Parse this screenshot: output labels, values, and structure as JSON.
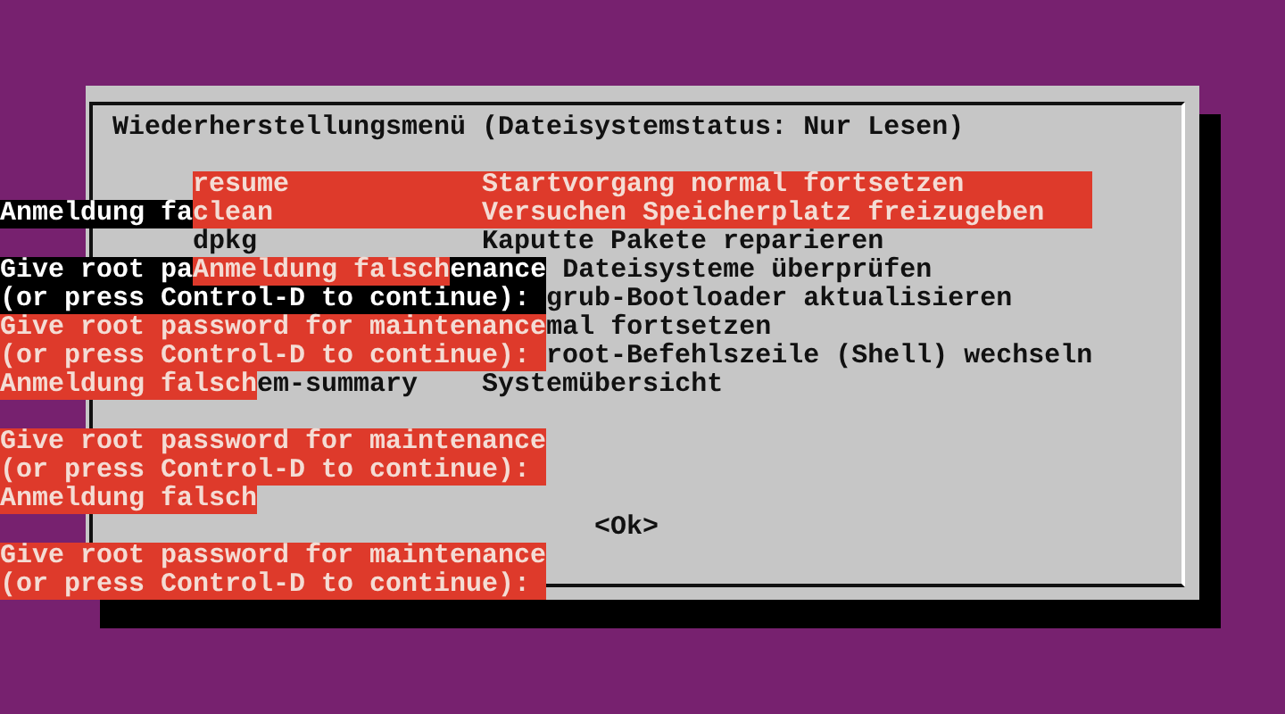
{
  "lines": [
    {
      "segments": [
        {
          "kind": "title",
          "text": "Wiederherstellungsmenü (Dateisystemstatus: Nur Lesen)"
        }
      ]
    },
    {
      "segments": [
        {
          "kind": "menu_item",
          "name": "resume",
          "description": "Startvorgang normal fortsetzen",
          "selected": true
        }
      ]
    },
    {
      "segments": [
        {
          "kind": "inverse",
          "text": "Anmeldung fa"
        },
        {
          "kind": "menu_item",
          "name": "clean",
          "description": "Versuchen Speicherplatz freizugeben",
          "selected": true
        }
      ]
    },
    {
      "segments": [
        {
          "kind": "menu_item",
          "name": "dpkg",
          "description": "Kaputte Pakete reparieren",
          "selected": false
        }
      ]
    },
    {
      "segments": [
        {
          "kind": "inverse",
          "text": "Give root pa"
        },
        {
          "kind": "alert",
          "text": "Anmeldung falsch"
        },
        {
          "kind": "inverse",
          "text": "enance"
        },
        {
          "kind": "text",
          "text": "Dateisysteme überprüfen"
        }
      ]
    },
    {
      "segments": [
        {
          "kind": "inverse",
          "text": "(or press Control-D to continue):"
        },
        {
          "kind": "text",
          "text": "grub-Bootloader aktualisieren"
        }
      ]
    },
    {
      "segments": [
        {
          "kind": "alert",
          "text": "Give root password for maintenance"
        },
        {
          "kind": "text",
          "text": "mal fortsetzen"
        }
      ]
    },
    {
      "segments": [
        {
          "kind": "alert",
          "text": "(or press Control-D to continue):"
        },
        {
          "kind": "text",
          "text": "root-Befehlszeile (Shell) wechseln"
        }
      ]
    },
    {
      "segments": [
        {
          "kind": "alert",
          "text": "Anmeldung falsch"
        },
        {
          "kind": "text",
          "text": "em-summary"
        },
        {
          "kind": "text",
          "text": "Systemübersicht"
        }
      ]
    },
    {
      "segments": [
        {
          "kind": "alert",
          "text": "Give root password for maintenance"
        }
      ]
    },
    {
      "segments": [
        {
          "kind": "alert",
          "text": "(or press Control-D to continue):"
        }
      ]
    },
    {
      "segments": [
        {
          "kind": "alert",
          "text": "Anmeldung falsch"
        }
      ]
    },
    {
      "segments": [
        {
          "kind": "button",
          "text": "<Ok>"
        }
      ]
    },
    {
      "segments": [
        {
          "kind": "alert",
          "text": "Give root password for maintenance"
        }
      ]
    },
    {
      "segments": [
        {
          "kind": "alert",
          "text": "(or press Control-D to continue):"
        }
      ]
    }
  ]
}
